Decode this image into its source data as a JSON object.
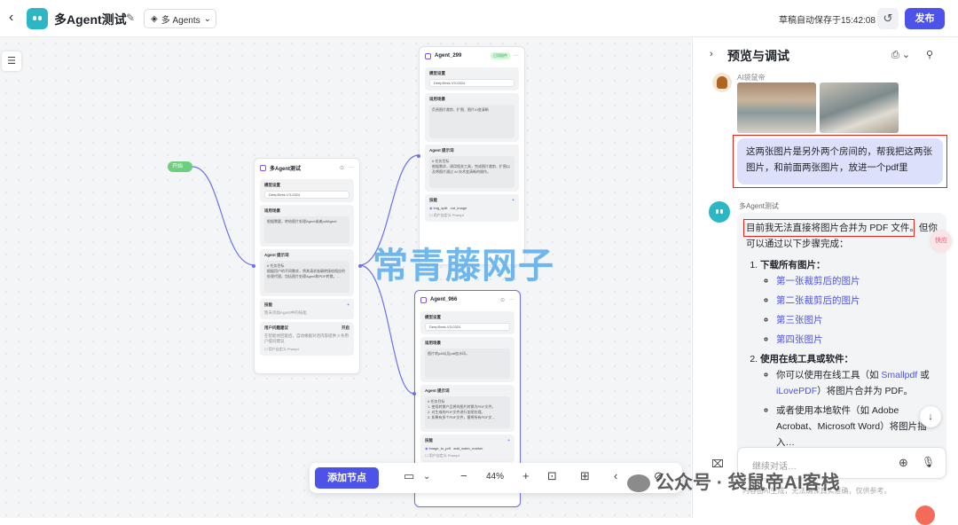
{
  "header": {
    "app_name": "多Agent测试",
    "mode_label": "多 Agents",
    "save_status": "草稿自动保存于15:42:08",
    "publish_label": "发布"
  },
  "canvas": {
    "start_label": "开始",
    "main_node": {
      "title": "多Agent测试",
      "model_label": "模型设置",
      "model_value": "DeepSeek-V3-0324",
      "scenario_label": "适用场景",
      "scenario_text": "根据需要，转给图片处理Agent或者pdfAgent",
      "prompt_label": "Agent 提示词",
      "prompt_text": "# 任务目标\n根据用户的不同需求，将其请求准确转接给相应的处理代理。包括图片处理Agent和PDF转换。…",
      "skills_label": "技能",
      "skills_text": "暂未添加Agent中的技能",
      "suggest_label": "用户问题建议",
      "suggest_value": "开启",
      "suggest_text": "在智能体回复后，自动根据对话内容提供 3 条用户提问建议",
      "custom_prompt_label": "用户自定义 Prompt"
    },
    "agent_299": {
      "title": "Agent_299",
      "badge": "已用插件",
      "model_label": "模型设置",
      "model_value": "DeepSeek-V3-0324",
      "scenario_label": "适用场景",
      "scenario_text": "负责图片裁剪、扩图、图片AI变清晰",
      "prompt_label": "Agent 提示词",
      "prompt_text": "# 任务目标\n根据需求，调用相关工具，完成图片裁剪、扩图以及将图片通过 AI 技术变清晰的操作。",
      "skills_label": "技能",
      "skill_1": "img_split",
      "skill_2": "cut_image",
      "custom_prompt_label": "用户自定义 Prompt"
    },
    "agent_966": {
      "title": "Agent_966",
      "model_label": "模型设置",
      "model_value": "DeepSeek-V3-0324",
      "scenario_label": "适用场景",
      "scenario_text": "图片转pdf以及pdf加水印。",
      "prompt_label": "Agent 提示词",
      "prompt_text": "# 任务目标\n1. 使用转换产品将的图片转换为PDF文件。\n2. 对生成的PDF文件进行加密处理。\n3. 如果有多个PDF文件，需将所有PDF文…",
      "skills_label": "技能",
      "skill_1": "image_to_pdf",
      "skill_2": "add_water_marker",
      "custom_prompt_label": "用户自定义 Prompt"
    },
    "watermark": "常青藤网子"
  },
  "toolbar": {
    "add_node_label": "添加节点",
    "zoom": "44%"
  },
  "panel": {
    "title": "预览与调试",
    "user_name": "AI袋鼠帝",
    "user_message": "这两张图片是另外两个房间的，帮我把这两张图片，和前面两张图片，放进一个pdf里",
    "bot_name": "多Agent测试",
    "bot_intro_highlight": "目前我无法直接将图片合并为 PDF 文件",
    "bot_intro_rest": "。但你可以通过以下步骤完成：",
    "step1_title": "下载所有图片：",
    "step1_links": [
      "第一张裁剪后的图片",
      "第二张裁剪后的图片",
      "第三张图片",
      "第四张图片"
    ],
    "step2_title": "使用在线工具或软件：",
    "step2_b1_pre": "你可以使用在线工具（如 ",
    "step2_b1_link1": "Smallpdf",
    "step2_b1_mid": " 或 ",
    "step2_b1_link2": "iLovePDF",
    "step2_b1_post": "）将图片合并为 PDF。",
    "step2_b2": "或者使用本地软件（如 Adobe Acrobat、Microsoft Word）将图片插入…",
    "input_placeholder": "继续对话…",
    "disclaimer": "内容由AI生成，无法确保真实准确，仅供参考。",
    "float_label": "快应"
  },
  "overlay": {
    "wechat_text": "公众号 · 袋鼠帝AI客栈"
  },
  "colors": {
    "accent": "#4d53e8",
    "start_green": "#6ccf7d",
    "highlight_red": "#e5241d",
    "user_bubble": "#dde0fa"
  }
}
